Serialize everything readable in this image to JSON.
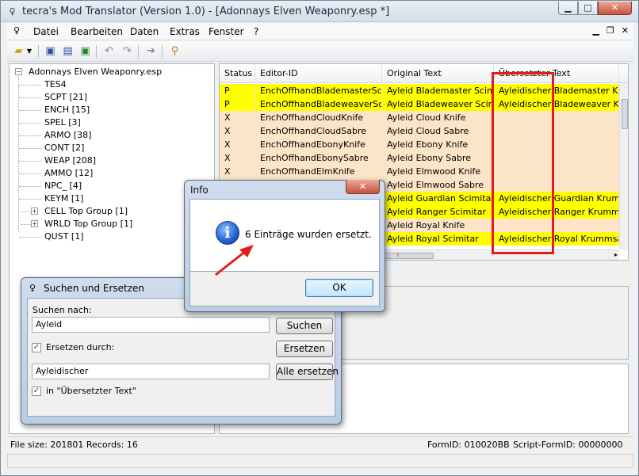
{
  "window": {
    "title": "tecra's Mod Translator (Version 1.0) - [Adonnays Elven Weaponry.esp *]",
    "caption_buttons": [
      "minimize",
      "maximize",
      "close"
    ]
  },
  "menu": [
    "Datei",
    "Bearbeiten",
    "Daten",
    "Extras",
    "Fenster",
    "?"
  ],
  "toolbar_icons": [
    "open-folder-icon",
    "dropdown-arrow-icon",
    "save-icon",
    "save-as-icon",
    "save-all-icon",
    "undo-icon",
    "redo-icon",
    "navigate-icon",
    "search-icon"
  ],
  "tree": {
    "root": "Adonnays Elven Weaponry.esp",
    "children": [
      {
        "label": "TES4",
        "expandable": false
      },
      {
        "label": "SCPT [21]",
        "expandable": false
      },
      {
        "label": "ENCH [15]",
        "expandable": false
      },
      {
        "label": "SPEL [3]",
        "expandable": false
      },
      {
        "label": "ARMO [38]",
        "expandable": false
      },
      {
        "label": "CONT [2]",
        "expandable": false
      },
      {
        "label": "WEAP [208]",
        "expandable": false
      },
      {
        "label": "AMMO [12]",
        "expandable": false
      },
      {
        "label": "NPC_ [4]",
        "expandable": false
      },
      {
        "label": "KEYM [1]",
        "expandable": false
      },
      {
        "label": "CELL Top Group [1]",
        "expandable": true
      },
      {
        "label": "WRLD Top Group [1]",
        "expandable": true
      },
      {
        "label": "QUST [1]",
        "expandable": false
      }
    ]
  },
  "grid": {
    "columns": [
      "Status",
      "Editor-ID",
      "Original Text",
      "Übersetzter Text"
    ],
    "rows": [
      {
        "status": "P",
        "editor_id": "EnchOffhandBlademasterScim",
        "original": "Ayleid Blademaster Scimitar",
        "translated": "Ayleidischer Blademaster Krumm",
        "style": "yellow"
      },
      {
        "status": "P",
        "editor_id": "EnchOffhandBladeweaverScim",
        "original": "Ayleid Bladeweaver Scimitar",
        "translated": "Ayleidischer Bladeweaver Krum",
        "style": "yellow"
      },
      {
        "status": "X",
        "editor_id": "EnchOffhandCloudKnife",
        "original": "Ayleid Cloud Knife",
        "translated": "",
        "style": "peach"
      },
      {
        "status": "X",
        "editor_id": "EnchOffhandCloudSabre",
        "original": "Ayleid Cloud Sabre",
        "translated": "",
        "style": "peach"
      },
      {
        "status": "X",
        "editor_id": "EnchOffhandEbonyKnife",
        "original": "Ayleid Ebony Knife",
        "translated": "",
        "style": "peach"
      },
      {
        "status": "X",
        "editor_id": "EnchOffhandEbonySabre",
        "original": "Ayleid Ebony Sabre",
        "translated": "",
        "style": "peach"
      },
      {
        "status": "X",
        "editor_id": "EnchOffhandElmKnife",
        "original": "Ayleid Elmwood Knife",
        "translated": "",
        "style": "peach"
      },
      {
        "status": "",
        "editor_id": "",
        "original": "Ayleid Elmwood Sabre",
        "translated": "",
        "style": "peach"
      },
      {
        "status": "",
        "editor_id": "",
        "original": "Ayleid Guardian Scimitar",
        "translated": "Ayleidischer Guardian Krummsä",
        "style": "yellow"
      },
      {
        "status": "",
        "editor_id": "",
        "original": "Ayleid Ranger Scimitar",
        "translated": "Ayleidischer Ranger Krummsäb",
        "style": "yellow"
      },
      {
        "status": "",
        "editor_id": "",
        "original": "Ayleid Royal Knife",
        "translated": "",
        "style": "peach"
      },
      {
        "status": "",
        "editor_id": "",
        "original": "Ayleid Royal Scimitar",
        "translated": "Ayleidischer Royal Krummsäbel",
        "style": "yellow"
      }
    ]
  },
  "status_bar": {
    "file_info": "File size: 201801 Records: 16",
    "form_id": "FormID:  010020BB",
    "script_form_id": "Script-FormID:  00000000"
  },
  "info_dialog": {
    "title": "Info",
    "message": "6 Einträge wurden ersetzt.",
    "ok_label": "OK"
  },
  "search_dialog": {
    "title": "Suchen und Ersetzen",
    "search_label": "Suchen nach:",
    "search_value": "Ayleid",
    "search_button": "Suchen",
    "replace_checkbox_label": "Ersetzen durch:",
    "replace_checked": true,
    "replace_button": "Ersetzen",
    "replace_value": "Ayleidischer",
    "replace_all_button": "Alle ersetzen",
    "scope_checkbox_label": "in \"Übersetzter Text\"",
    "scope_checked": true
  },
  "colors": {
    "replaced_row": "#ffff00",
    "untranslated_row": "#fce4c8",
    "highlight_box": "#e31b1b",
    "arrow": "#e31b1b"
  }
}
